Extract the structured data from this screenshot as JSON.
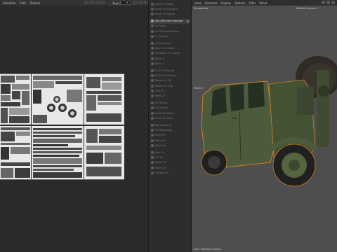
{
  "uv_editor": {
    "menu": [
      "Selection",
      "Fold",
      "Texture"
    ],
    "object_dropdown": "Object",
    "dropdown_arrow": "▾"
  },
  "command_panel": {
    "items": [
      {
        "label": "Select UV Edges",
        "active": false
      },
      {
        "label": "Select UV Polygons",
        "active": false
      },
      {
        "label": "Select UV Islands",
        "active": false
      },
      {
        "label": "Set UVW from Projection",
        "active": true
      },
      {
        "label": "UV Relax",
        "active": false
      },
      {
        "label": "UV Optimal Mapping",
        "active": false
      },
      {
        "label": "UV Packing",
        "active": false
      },
      {
        "label": "UV Transform",
        "active": false
      },
      {
        "label": "Align UV Islands",
        "active": false
      },
      {
        "label": "Straighten UV Islands",
        "active": false
      },
      {
        "label": "Mirror U",
        "active": false
      },
      {
        "label": "Mirror V",
        "active": false
      },
      {
        "label": "Fit UV to Canvas",
        "active": false
      },
      {
        "label": "Fit UV to Selection",
        "active": false
      },
      {
        "label": "Rotate UV CW",
        "active": false
      },
      {
        "label": "Rotate UV CCW",
        "active": false
      },
      {
        "label": "Grid UV",
        "active": false
      },
      {
        "label": "Weld UV",
        "active": false
      },
      {
        "label": "UV Terrace",
        "active": false
      },
      {
        "label": "UV Unwrap",
        "active": false
      },
      {
        "label": "Break UV Seams",
        "active": false
      },
      {
        "label": "Snap UV Points",
        "active": false
      },
      {
        "label": "Randomize UV",
        "active": false
      },
      {
        "label": "UV Retopology",
        "active": false
      },
      {
        "label": "Scale UV",
        "active": false
      },
      {
        "label": "Move UV",
        "active": false
      },
      {
        "label": "Stitch UV",
        "active": false
      },
      {
        "label": "Sew UV",
        "active": false
      },
      {
        "label": "Cut UV",
        "active": false
      },
      {
        "label": "Select UV",
        "active": false
      },
      {
        "label": "Invert UV",
        "active": false
      },
      {
        "label": "Convert UV",
        "active": false
      }
    ]
  },
  "viewport": {
    "menu": [
      "View",
      "Cameras",
      "Display",
      "Options",
      "Filter",
      "Panel"
    ],
    "projection": "Perspective",
    "camera": "Default Camera ▾",
    "object_marker": "Mover ▾",
    "footer": "View Transform: Scene"
  },
  "colors": {
    "accent_active": "#e6e6e6",
    "truck_body": "#4a5a3a",
    "selection_outline": "#d0802a"
  }
}
